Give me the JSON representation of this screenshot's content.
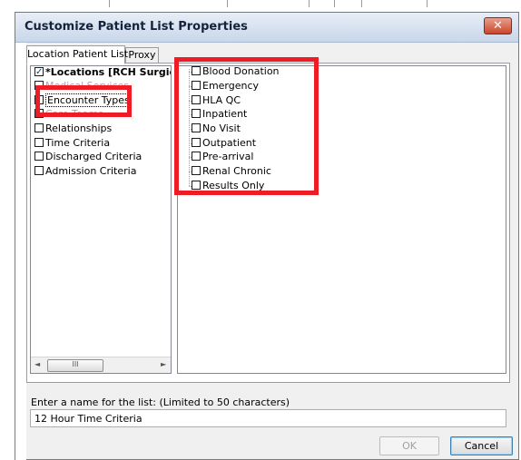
{
  "window": {
    "title": "Customize Patient List Properties",
    "close_symbol": "✕"
  },
  "tabs": [
    {
      "label": "Location Patient List",
      "active": true
    },
    {
      "label": "Proxy",
      "active": false
    }
  ],
  "left_tree": {
    "items": [
      {
        "label": "*Locations [RCH Surgica",
        "checked": true,
        "bold": true
      },
      {
        "label": "Medical Services",
        "checked": false,
        "obscured": true
      },
      {
        "label": "Encounter Types",
        "checked": false,
        "selected": true
      },
      {
        "label": "Care Teams",
        "checked": false,
        "obscured": true
      },
      {
        "label": "Relationships",
        "checked": false
      },
      {
        "label": "Time Criteria",
        "checked": false
      },
      {
        "label": "Discharged Criteria",
        "checked": false
      },
      {
        "label": "Admission Criteria",
        "checked": false
      }
    ],
    "scrollbar": {
      "left_arrow": "◄",
      "right_arrow": "►",
      "thumb_grip": "III"
    }
  },
  "encounter_types": {
    "items": [
      {
        "label": "Blood Donation",
        "checked": false
      },
      {
        "label": "Emergency",
        "checked": false
      },
      {
        "label": "HLA QC",
        "checked": false
      },
      {
        "label": "Inpatient",
        "checked": false
      },
      {
        "label": "No Visit",
        "checked": false
      },
      {
        "label": "Outpatient",
        "checked": false
      },
      {
        "label": "Pre-arrival",
        "checked": false
      },
      {
        "label": "Renal Chronic",
        "checked": false
      },
      {
        "label": "Results Only",
        "checked": false
      }
    ]
  },
  "name_field": {
    "label": "Enter a name for the list: (Limited to 50 characters)",
    "value": "12 Hour Time Criteria"
  },
  "buttons": {
    "ok": "OK",
    "cancel": "Cancel"
  },
  "colors": {
    "highlight_box": "#ee1c25",
    "title_text": "#14233c",
    "close_button": "#c9462b"
  },
  "icons": {
    "close": "close-icon",
    "checkbox": "checkbox-icon",
    "scroll_left": "arrow-left-icon",
    "scroll_right": "arrow-right-icon"
  }
}
